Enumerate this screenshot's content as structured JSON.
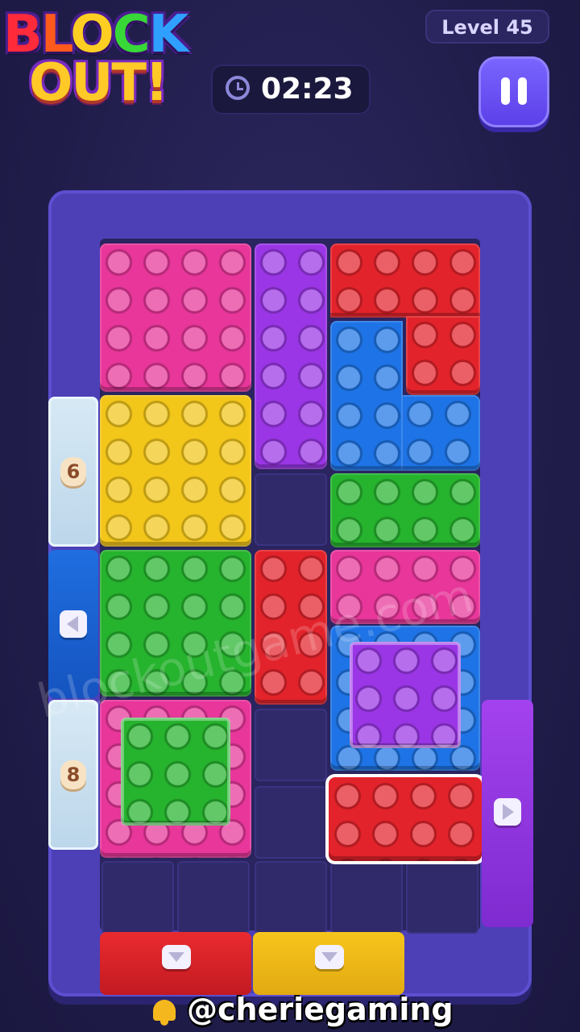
{
  "header": {
    "logo_line1": [
      "B",
      "L",
      "O",
      "C",
      "K"
    ],
    "logo_line2": "OUT!",
    "level_label": "Level 45",
    "timer": "02:23",
    "timer_icon": "clock-icon",
    "pause_icon": "pause-icon"
  },
  "board": {
    "side_counters": {
      "left_top": "6",
      "left_bottom": "8"
    },
    "exit_arrows": [
      "left",
      "right",
      "down",
      "down"
    ],
    "blocks": [
      {
        "color": "pink"
      },
      {
        "color": "purple"
      },
      {
        "color": "red"
      },
      {
        "color": "blue"
      },
      {
        "color": "yellow"
      },
      {
        "color": "green"
      },
      {
        "color": "green"
      },
      {
        "color": "red"
      },
      {
        "color": "pink"
      },
      {
        "color": "blue"
      },
      {
        "color": "pink"
      },
      {
        "color": "red",
        "selected": true
      }
    ],
    "watermark": "blockoutgame.com"
  },
  "footer": {
    "handle": "@cheriegaming",
    "icon": "bell-icon"
  },
  "colors": {
    "pink": "#e8369a",
    "purple": "#9a36e6",
    "red": "#e3232b",
    "blue": "#1e74e6",
    "yellow": "#f3c61a",
    "green": "#26b32e"
  }
}
